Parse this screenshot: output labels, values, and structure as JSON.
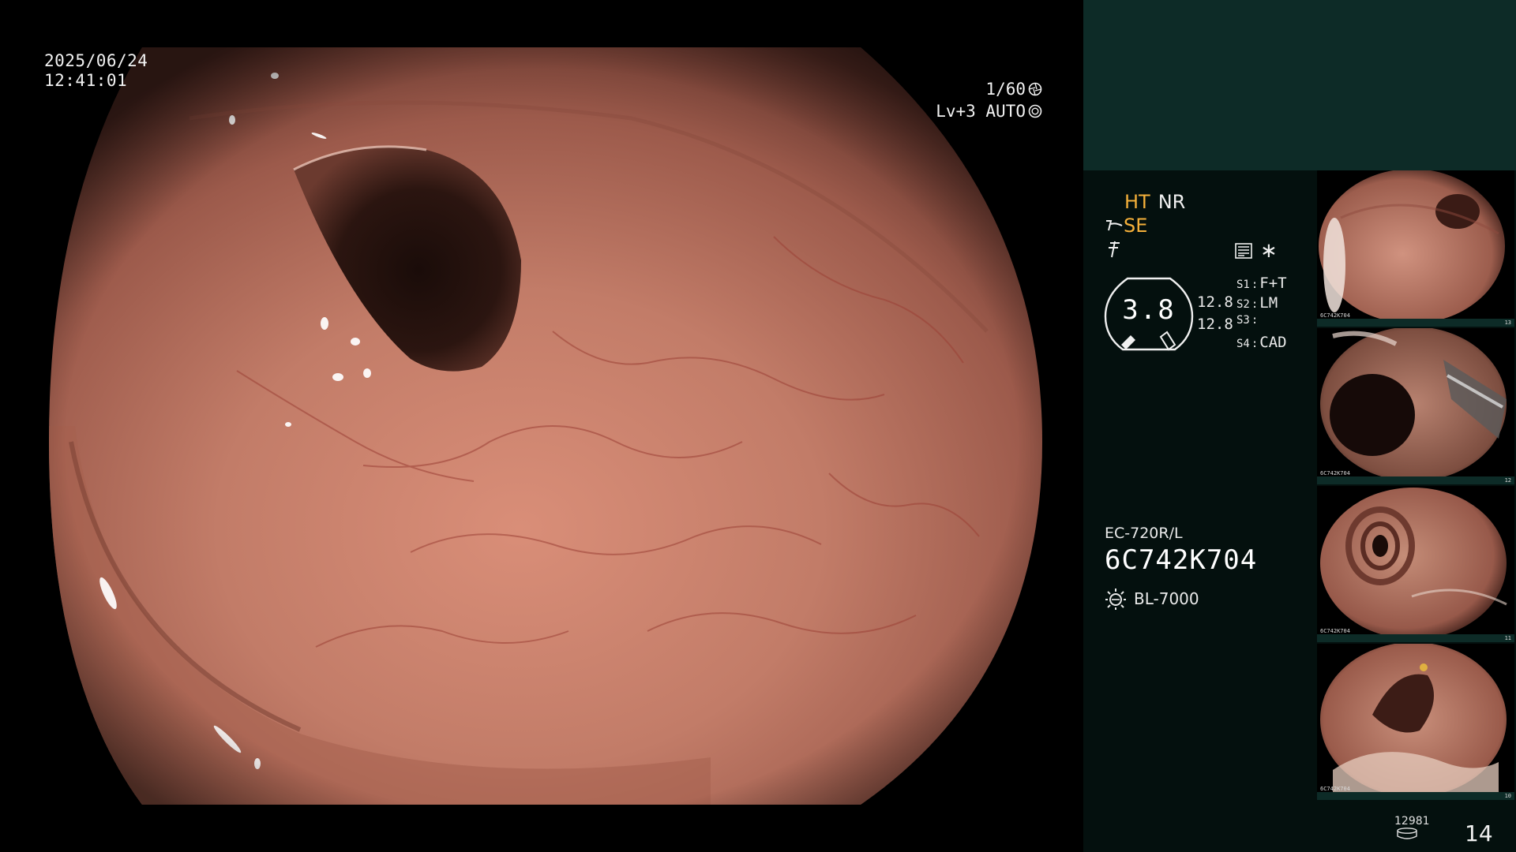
{
  "main": {
    "date": "2025/06/24",
    "time": "12:41:01",
    "shutter": "1/60",
    "level": "Lv+3 AUTO"
  },
  "panel": {
    "mode_ht": "HT",
    "mode_nr": "NR",
    "mode_se": "SE",
    "gauge_value": "3.8",
    "gauge_side_1": "12.8",
    "gauge_side_2": "12.8",
    "presets": [
      {
        "key": "S1",
        "value": "F+T"
      },
      {
        "key": "S2",
        "value": "LM"
      },
      {
        "key": "S3",
        "value": ""
      },
      {
        "key": "S4",
        "value": "CAD"
      }
    ],
    "scope_model": "EC-720R/L",
    "serial": "6C742K704",
    "light_source": "BL-7000",
    "counter_small": "12981",
    "counter_big": "14"
  },
  "thumbnails": [
    {
      "label": "6C742K704",
      "index": "13"
    },
    {
      "label": "6C742K704",
      "index": "12"
    },
    {
      "label": "6C742K704",
      "index": "11"
    },
    {
      "label": "6C742K704",
      "index": "10"
    }
  ],
  "colors": {
    "accent_orange": "#f5b03a",
    "panel_dark": "#04100e",
    "panel_teal": "#0d2b27",
    "tissue": "#b97360"
  }
}
